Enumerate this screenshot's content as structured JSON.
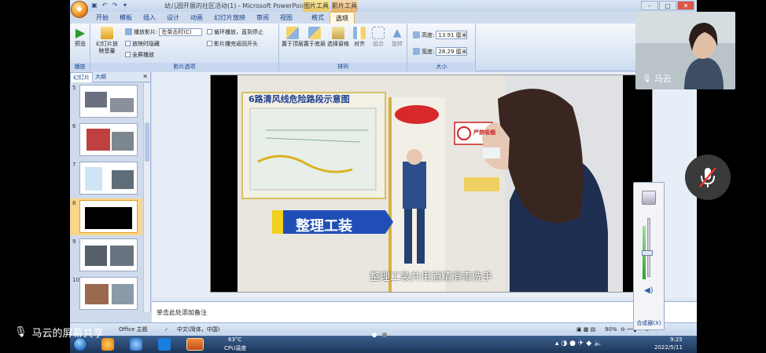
{
  "window": {
    "title": "幼儿园开展的社区活动(1) - Microsoft PowerPoint",
    "contextual_tabs": [
      "图片工具",
      "影片工具"
    ]
  },
  "ribbon": {
    "tabs": [
      "开始",
      "模板",
      "插入",
      "设计",
      "动画",
      "幻灯片放映",
      "审阅",
      "视图",
      "格式",
      "选项"
    ],
    "active_tab": "选项",
    "groups": {
      "play": {
        "label": "播放",
        "preview": "预览"
      },
      "movie_options": {
        "label": "影片选项",
        "slide_volume": "幻灯片放映音量",
        "play_movie": "播放影片:",
        "play_movie_value": "在单击时(C)",
        "hide_when_not_playing": "放映时隐藏",
        "fullscreen": "全屏播放",
        "loop": "循环播放，直到停止",
        "rewind": "影片播完返回开头"
      },
      "arrange": {
        "label": "排列",
        "bring_front": "置于顶层",
        "send_back": "置于底层",
        "selection_pane": "选择窗格",
        "align": "对齐",
        "group": "组合",
        "rotate": "旋转"
      },
      "size": {
        "label": "大小",
        "height_label": "高度:",
        "height_value": "13.91 厘米",
        "width_label": "宽度:",
        "width_value": "28.29 厘米"
      }
    }
  },
  "slide_panel": {
    "tabs": [
      "幻灯片",
      "大纲"
    ],
    "thumbnails": [
      {
        "num": "5"
      },
      {
        "num": "6"
      },
      {
        "num": "7"
      },
      {
        "num": "8"
      },
      {
        "num": "9"
      },
      {
        "num": "10"
      }
    ],
    "selected_index": 3
  },
  "slide": {
    "map_title": "6路清风线危险路段示意图",
    "banner_text": "整理工装",
    "sign_text": "严禁吸烟",
    "subtitle": "整理工装并用酒精消毒洗手"
  },
  "notes": {
    "placeholder": "单击此处添加备注"
  },
  "statusbar": {
    "theme": "Office 主题",
    "language": "中文(简体，中国)",
    "zoom": "90%"
  },
  "taskbar": {
    "temp": "63°C",
    "temp_label": "CPU温度",
    "time": "9:25",
    "date": "2022/5/11"
  },
  "meeting": {
    "participant_name": "马云",
    "screenshare_label": "马云的屏幕共享",
    "mixer_label": "合成器(X)"
  }
}
